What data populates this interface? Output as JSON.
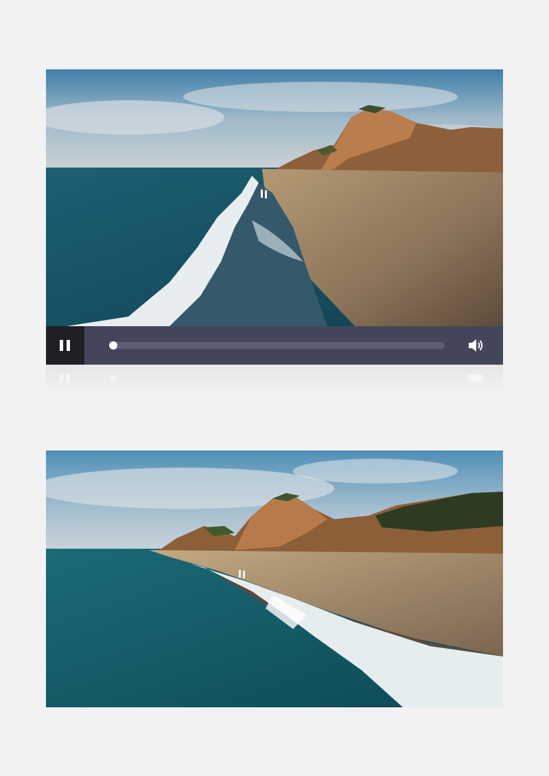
{
  "player": {
    "state": "playing",
    "progress": 0.0,
    "icons": {
      "play_pause": "pause-icon",
      "volume": "volume-icon"
    },
    "colors": {
      "control_bar": "#43465b",
      "button_bg": "#1f2024",
      "track": "#5b5e75",
      "thumb": "#ffffff"
    }
  },
  "videos": [
    {
      "scene": "beach-video-frame"
    },
    {
      "scene": "beach-video-frame"
    }
  ]
}
